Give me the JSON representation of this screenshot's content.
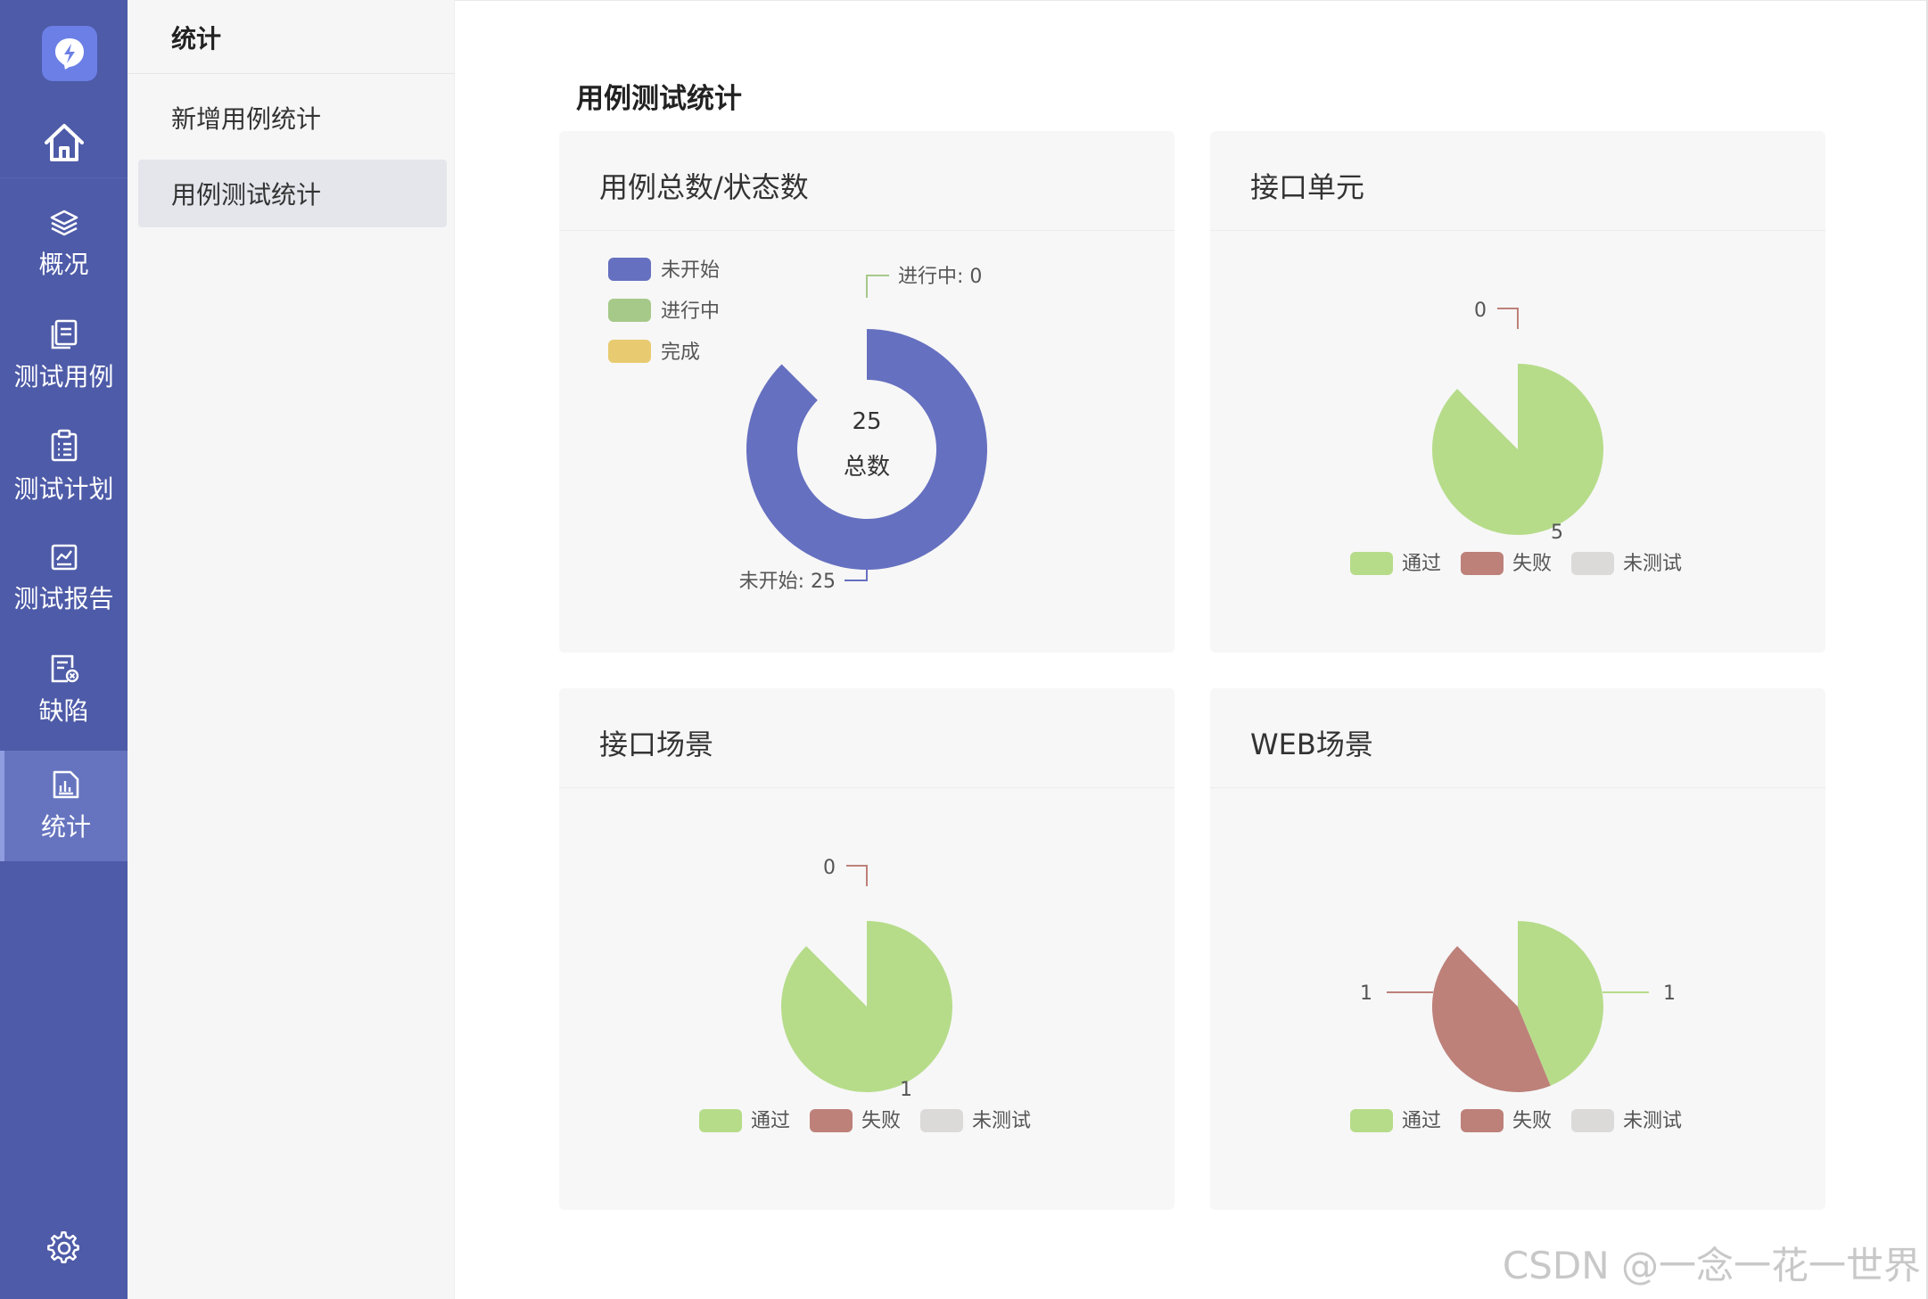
{
  "colors": {
    "rail": "#4e5ba8",
    "not_started": "#6670c0",
    "in_progress": "#a6c98a",
    "done": "#e8cb70",
    "pass": "#b6dc8a",
    "fail": "#bd817a",
    "untested": "#dcd9d9"
  },
  "rail": {
    "nav": [
      {
        "id": "overview",
        "icon": "layers-icon",
        "label": "概况"
      },
      {
        "id": "test-cases",
        "icon": "document-icon",
        "label": "测试用例"
      },
      {
        "id": "test-plan",
        "icon": "clipboard-icon",
        "label": "测试计划"
      },
      {
        "id": "test-report",
        "icon": "report-chart-icon",
        "label": "测试报告"
      },
      {
        "id": "defects",
        "icon": "bug-document-icon",
        "label": "缺陷"
      },
      {
        "id": "stats",
        "icon": "bar-chart-document-icon",
        "label": "统计"
      }
    ]
  },
  "subnav": {
    "title": "统计",
    "items": [
      "新增用例统计",
      "用例测试统计"
    ]
  },
  "main": {
    "title": "用例测试统计"
  },
  "cards": [
    {
      "title": "用例总数/状态数"
    },
    {
      "title": "接口单元"
    },
    {
      "title": "接口场景"
    },
    {
      "title": "WEB场景"
    }
  ],
  "chart_data": [
    {
      "type": "pie",
      "variant": "donut",
      "title": "用例总数/状态数",
      "center_value": "25",
      "center_label": "总数",
      "legend": [
        "未开始",
        "进行中",
        "完成"
      ],
      "legend_position": "top-left",
      "slices": [
        {
          "name": "未开始",
          "value": 25,
          "label": "未开始: 25"
        },
        {
          "name": "进行中",
          "value": 0,
          "label": "进行中: 0"
        },
        {
          "name": "完成",
          "value": 0
        }
      ]
    },
    {
      "type": "pie",
      "title": "接口单元",
      "legend": [
        "通过",
        "失败",
        "未测试"
      ],
      "legend_position": "bottom",
      "slices": [
        {
          "name": "通过",
          "value": 5,
          "label": "5"
        },
        {
          "name": "失败",
          "value": 0,
          "label": "0"
        },
        {
          "name": "未测试",
          "value": 0
        }
      ]
    },
    {
      "type": "pie",
      "title": "接口场景",
      "legend": [
        "通过",
        "失败",
        "未测试"
      ],
      "legend_position": "bottom",
      "slices": [
        {
          "name": "通过",
          "value": 1,
          "label": "1"
        },
        {
          "name": "失败",
          "value": 0,
          "label": "0"
        },
        {
          "name": "未测试",
          "value": 0
        }
      ]
    },
    {
      "type": "pie",
      "title": "WEB场景",
      "legend": [
        "通过",
        "失败",
        "未测试"
      ],
      "legend_position": "bottom",
      "slices": [
        {
          "name": "通过",
          "value": 1,
          "label": "1"
        },
        {
          "name": "失败",
          "value": 1,
          "label": "1"
        },
        {
          "name": "未测试",
          "value": 0
        }
      ]
    }
  ],
  "watermark": "CSDN @一念一花一世界"
}
